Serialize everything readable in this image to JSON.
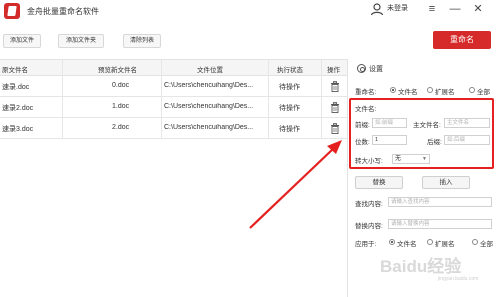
{
  "app": {
    "title": "金舟批量重命名软件",
    "user_label": "未登录",
    "menu_icon": "≡",
    "minimize_icon": "—",
    "close_icon": "✕"
  },
  "toolbar": {
    "add_file": "添加文件",
    "add_folder": "添加文件夹",
    "clear_list": "清除列表",
    "rename": "重命名"
  },
  "table": {
    "headers": [
      "原文件名",
      "预览新文件名",
      "文件位置",
      "执行状态",
      "操作"
    ],
    "rows": [
      {
        "original": "速录.doc",
        "preview": "0.doc",
        "location": "C:\\Users\\chencuihang\\Des...",
        "status": "待操作"
      },
      {
        "original": "速录2.doc",
        "preview": "1.doc",
        "location": "C:\\Users\\chencuihang\\Des...",
        "status": "待操作"
      },
      {
        "original": "速录3.doc",
        "preview": "2.doc",
        "location": "C:\\Users\\chencuihang\\Des...",
        "status": "待操作"
      }
    ]
  },
  "settings": {
    "title": "设置",
    "rename_label": "重命名:",
    "rename_options": [
      "文件名",
      "扩展名",
      "全部"
    ],
    "filename_section": "文件名:",
    "prefix_label": "前缀:",
    "prefix_placeholder": "如:前缀",
    "main_name_label": "主文件名:",
    "main_name_placeholder": "主文件名",
    "digits_label": "位数:",
    "digits_value": "1",
    "suffix_label": "后缀:",
    "suffix_placeholder": "如:后缀",
    "case_label": "转大小写:",
    "case_value": "无",
    "replace_button": "替换",
    "insert_button": "插入",
    "find_label": "查找内容:",
    "find_placeholder": "请输入查找内容",
    "replace_label": "替换内容:",
    "replace_placeholder": "请输入替换内容",
    "apply_label": "应用于:",
    "apply_options": [
      "文件名",
      "扩展名",
      "全部"
    ]
  },
  "watermark": {
    "text": "Baidu经验",
    "sub": "jingyan.baidu.com"
  },
  "colors": {
    "accent_red": "#d62a2a",
    "highlight_red": "#e52020"
  }
}
